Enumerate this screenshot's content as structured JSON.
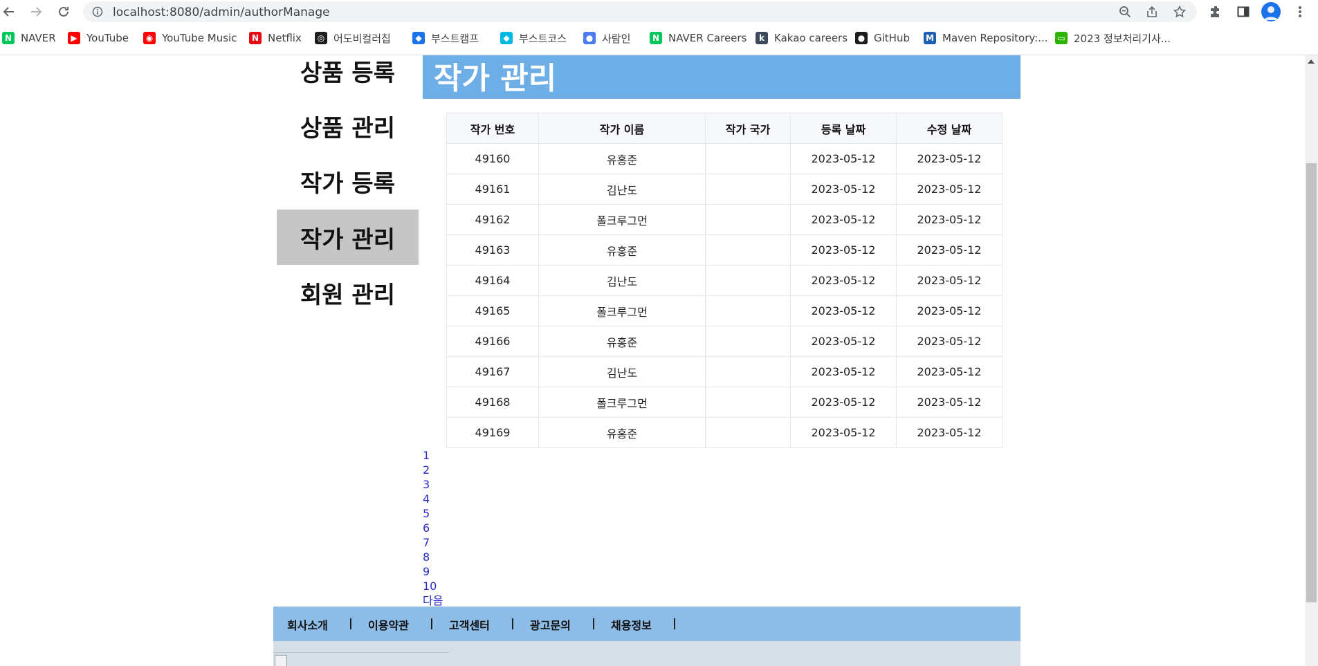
{
  "browser": {
    "url": "localhost:8080/admin/authorManage",
    "bookmarks": [
      {
        "label": "NAVER",
        "icon": "naver-icon",
        "color": "#03c75a"
      },
      {
        "label": "YouTube",
        "icon": "youtube-icon",
        "color": "#ff0000"
      },
      {
        "label": "YouTube Music",
        "icon": "youtube-music-icon",
        "color": "#ff0000"
      },
      {
        "label": "Netflix",
        "icon": "netflix-icon",
        "color": "#e50914"
      },
      {
        "label": "어도비컬러칩",
        "icon": "adobe-color-icon",
        "color": "#1d1d1d"
      },
      {
        "label": "부스트캠프",
        "icon": "boostcamp-icon",
        "color": "#1a73e8"
      },
      {
        "label": "부스트코스",
        "icon": "boostcourse-icon",
        "color": "#00b8e0"
      },
      {
        "label": "사람인",
        "icon": "saramin-icon",
        "color": "#4b7bec"
      },
      {
        "label": "NAVER Careers",
        "icon": "naver-careers-icon",
        "color": "#03c75a"
      },
      {
        "label": "Kakao careers",
        "icon": "kakao-careers-icon",
        "color": "#3c4b5c"
      },
      {
        "label": "GitHub",
        "icon": "github-icon",
        "color": "#1d1d1d"
      },
      {
        "label": "Maven Repository:...",
        "icon": "maven-icon",
        "color": "#1a5fb4"
      },
      {
        "label": "2023 정보처리기사...",
        "icon": "chat-icon",
        "color": "#2db400"
      }
    ]
  },
  "sidebar": {
    "items": [
      {
        "label": "상품 등록",
        "active": false
      },
      {
        "label": "상품 관리",
        "active": false
      },
      {
        "label": "작가 등록",
        "active": false
      },
      {
        "label": "작가 관리",
        "active": true
      },
      {
        "label": "회원 관리",
        "active": false
      }
    ]
  },
  "page": {
    "title": "작가 관리"
  },
  "table": {
    "headers": [
      "작가 번호",
      "작가 이름",
      "작가 국가",
      "등록 날짜",
      "수정 날짜"
    ],
    "rows": [
      [
        "49160",
        "유홍준",
        "",
        "2023-05-12",
        "2023-05-12"
      ],
      [
        "49161",
        "김난도",
        "",
        "2023-05-12",
        "2023-05-12"
      ],
      [
        "49162",
        "폴크루그먼",
        "",
        "2023-05-12",
        "2023-05-12"
      ],
      [
        "49163",
        "유홍준",
        "",
        "2023-05-12",
        "2023-05-12"
      ],
      [
        "49164",
        "김난도",
        "",
        "2023-05-12",
        "2023-05-12"
      ],
      [
        "49165",
        "폴크루그먼",
        "",
        "2023-05-12",
        "2023-05-12"
      ],
      [
        "49166",
        "유홍준",
        "",
        "2023-05-12",
        "2023-05-12"
      ],
      [
        "49167",
        "김난도",
        "",
        "2023-05-12",
        "2023-05-12"
      ],
      [
        "49168",
        "폴크루그먼",
        "",
        "2023-05-12",
        "2023-05-12"
      ],
      [
        "49169",
        "유홍준",
        "",
        "2023-05-12",
        "2023-05-12"
      ]
    ]
  },
  "pagination": {
    "pages": [
      "1",
      "2",
      "3",
      "4",
      "5",
      "6",
      "7",
      "8",
      "9",
      "10"
    ],
    "next_label": "다음"
  },
  "footer": {
    "links": [
      "회사소개",
      "이용약관",
      "고객센터",
      "광고문의",
      "채용정보"
    ],
    "separator": "|"
  }
}
